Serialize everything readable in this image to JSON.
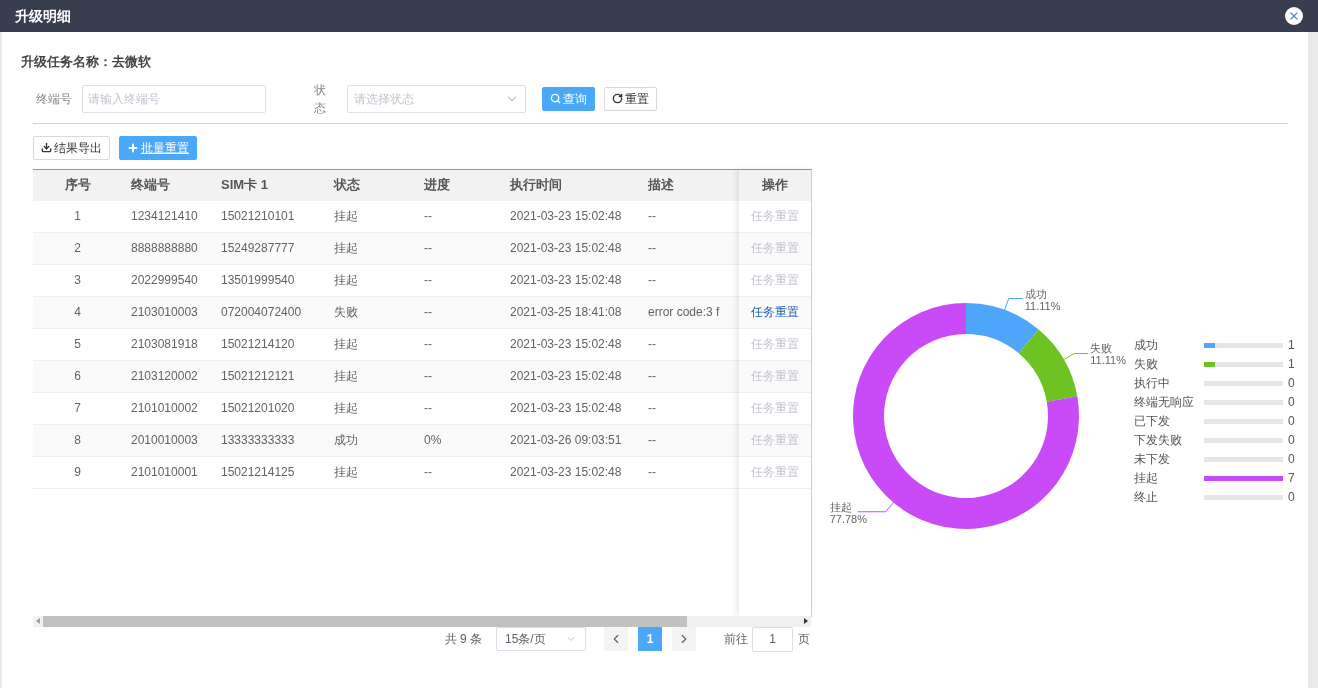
{
  "dialog": {
    "title": "升级明细"
  },
  "task": {
    "label": "升级任务名称：",
    "value": "去微软"
  },
  "filters": [
    {
      "kind": "input",
      "label": "终端号",
      "placeholder": "请输入终端号"
    },
    {
      "kind": "select",
      "label": "状态",
      "placeholder": "请选择状态"
    }
  ],
  "filter_buttons": [
    {
      "kind": "primary",
      "label": "查询"
    },
    {
      "kind": "default",
      "label": "重置"
    }
  ],
  "toolbar": [
    {
      "kind": "default",
      "label": "结果导出"
    },
    {
      "kind": "primary",
      "label": "批量重置"
    }
  ],
  "table": {
    "columns": [
      "序号",
      "终端号",
      "SIM卡 1",
      "状态",
      "进度",
      "执行时间",
      "描述",
      "操作"
    ],
    "rows": [
      {
        "cells": [
          "1",
          "1234121410",
          "15021210101",
          "挂起",
          "--",
          "2021-03-23 15:02:48",
          "--"
        ],
        "action": "任务重置",
        "disabled": true
      },
      {
        "cells": [
          "2",
          "8888888880",
          "15249287777",
          "挂起",
          "--",
          "2021-03-23 15:02:48",
          "--"
        ],
        "action": "任务重置",
        "disabled": true
      },
      {
        "cells": [
          "3",
          "2022999540",
          "13501999540",
          "挂起",
          "--",
          "2021-03-23 15:02:48",
          "--"
        ],
        "action": "任务重置",
        "disabled": true
      },
      {
        "cells": [
          "4",
          "2103010003",
          "072004072400",
          "失败",
          "--",
          "2021-03-25 18:41:08",
          "error code:3 f"
        ],
        "action": "任务重置",
        "disabled": false
      },
      {
        "cells": [
          "5",
          "2103081918",
          "15021214120",
          "挂起",
          "--",
          "2021-03-23 15:02:48",
          "--"
        ],
        "action": "任务重置",
        "disabled": true
      },
      {
        "cells": [
          "6",
          "2103120002",
          "15021212121",
          "挂起",
          "--",
          "2021-03-23 15:02:48",
          "--"
        ],
        "action": "任务重置",
        "disabled": true
      },
      {
        "cells": [
          "7",
          "2101010002",
          "15021201020",
          "挂起",
          "--",
          "2021-03-23 15:02:48",
          "--"
        ],
        "action": "任务重置",
        "disabled": true
      },
      {
        "cells": [
          "8",
          "2010010003",
          "13333333333",
          "成功",
          "0%",
          "2021-03-26 09:03:51",
          "--"
        ],
        "action": "任务重置",
        "disabled": true
      },
      {
        "cells": [
          "9",
          "2101010001",
          "15021214125",
          "挂起",
          "--",
          "2021-03-23 15:02:48",
          "--"
        ],
        "action": "任务重置",
        "disabled": true
      }
    ]
  },
  "pagination": {
    "total": "共 9 条",
    "page_size": "15条/页",
    "pages": [
      {
        "label": "1",
        "selected": true
      }
    ],
    "goto_label": "前往",
    "goto_value": "1",
    "goto_suffix": "页"
  },
  "chart": {
    "chart_data": {
      "type": "donut",
      "categories": [
        "成功",
        "失败",
        "挂起"
      ],
      "series": [
        {
          "values": [
            11.11,
            11.11,
            77.78
          ]
        }
      ],
      "colors": [
        "#4da6fa",
        "#6cc322",
        "#c84bf7"
      ],
      "value_labels": [
        "11.11%",
        "11.11%",
        "77.78%"
      ]
    }
  },
  "legend": [
    {
      "name": "成功",
      "count": "1",
      "level": 0.143,
      "color": "#4da6fa"
    },
    {
      "name": "失败",
      "count": "1",
      "level": 0.143,
      "color": "#6cc322"
    },
    {
      "name": "执行中",
      "count": "0"
    },
    {
      "name": "终端无响应",
      "count": "0"
    },
    {
      "name": "已下发",
      "count": "0"
    },
    {
      "name": "下发失败",
      "count": "0"
    },
    {
      "name": "未下发",
      "count": "0"
    },
    {
      "name": "挂起",
      "count": "7",
      "level": 1,
      "color": "#c84bf7"
    },
    {
      "name": "终止",
      "count": "0"
    }
  ]
}
